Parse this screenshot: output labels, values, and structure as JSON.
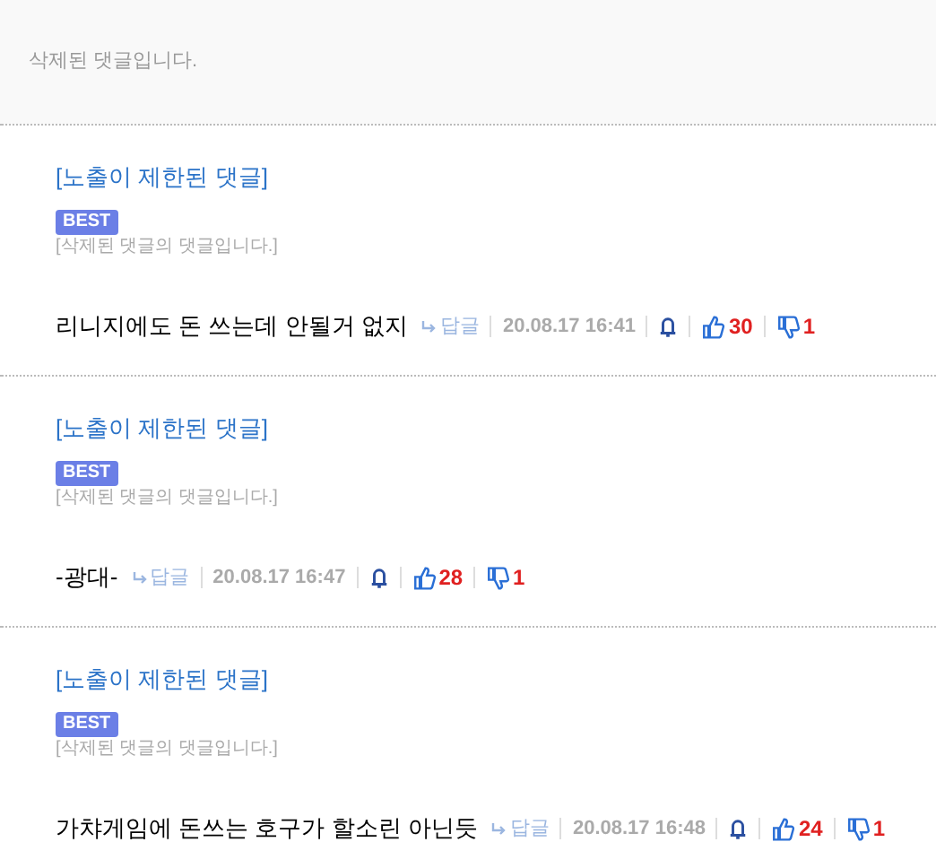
{
  "deleted_notice": "삭제된 댓글입니다.",
  "comments": [
    {
      "restricted_label": "[노출이 제한된 댓글]",
      "badge": "BEST",
      "parent_notice": "[삭제된 댓글의 댓글입니다.]",
      "text": "리니지에도 돈 쓰는데 안될거 없지",
      "reply": "답글",
      "date": "20.08.17 16:41",
      "likes": "30",
      "dislikes": "1"
    },
    {
      "restricted_label": "[노출이 제한된 댓글]",
      "badge": "BEST",
      "parent_notice": "[삭제된 댓글의 댓글입니다.]",
      "text": "-광대-",
      "reply": "답글",
      "date": "20.08.17 16:47",
      "likes": "28",
      "dislikes": "1"
    },
    {
      "restricted_label": "[노출이 제한된 댓글]",
      "badge": "BEST",
      "parent_notice": "[삭제된 댓글의 댓글입니다.]",
      "text": "가챠게임에 돈쓰는 호구가 할소린 아닌듯",
      "reply": "답글",
      "date": "20.08.17 16:48",
      "likes": "24",
      "dislikes": "1"
    }
  ]
}
